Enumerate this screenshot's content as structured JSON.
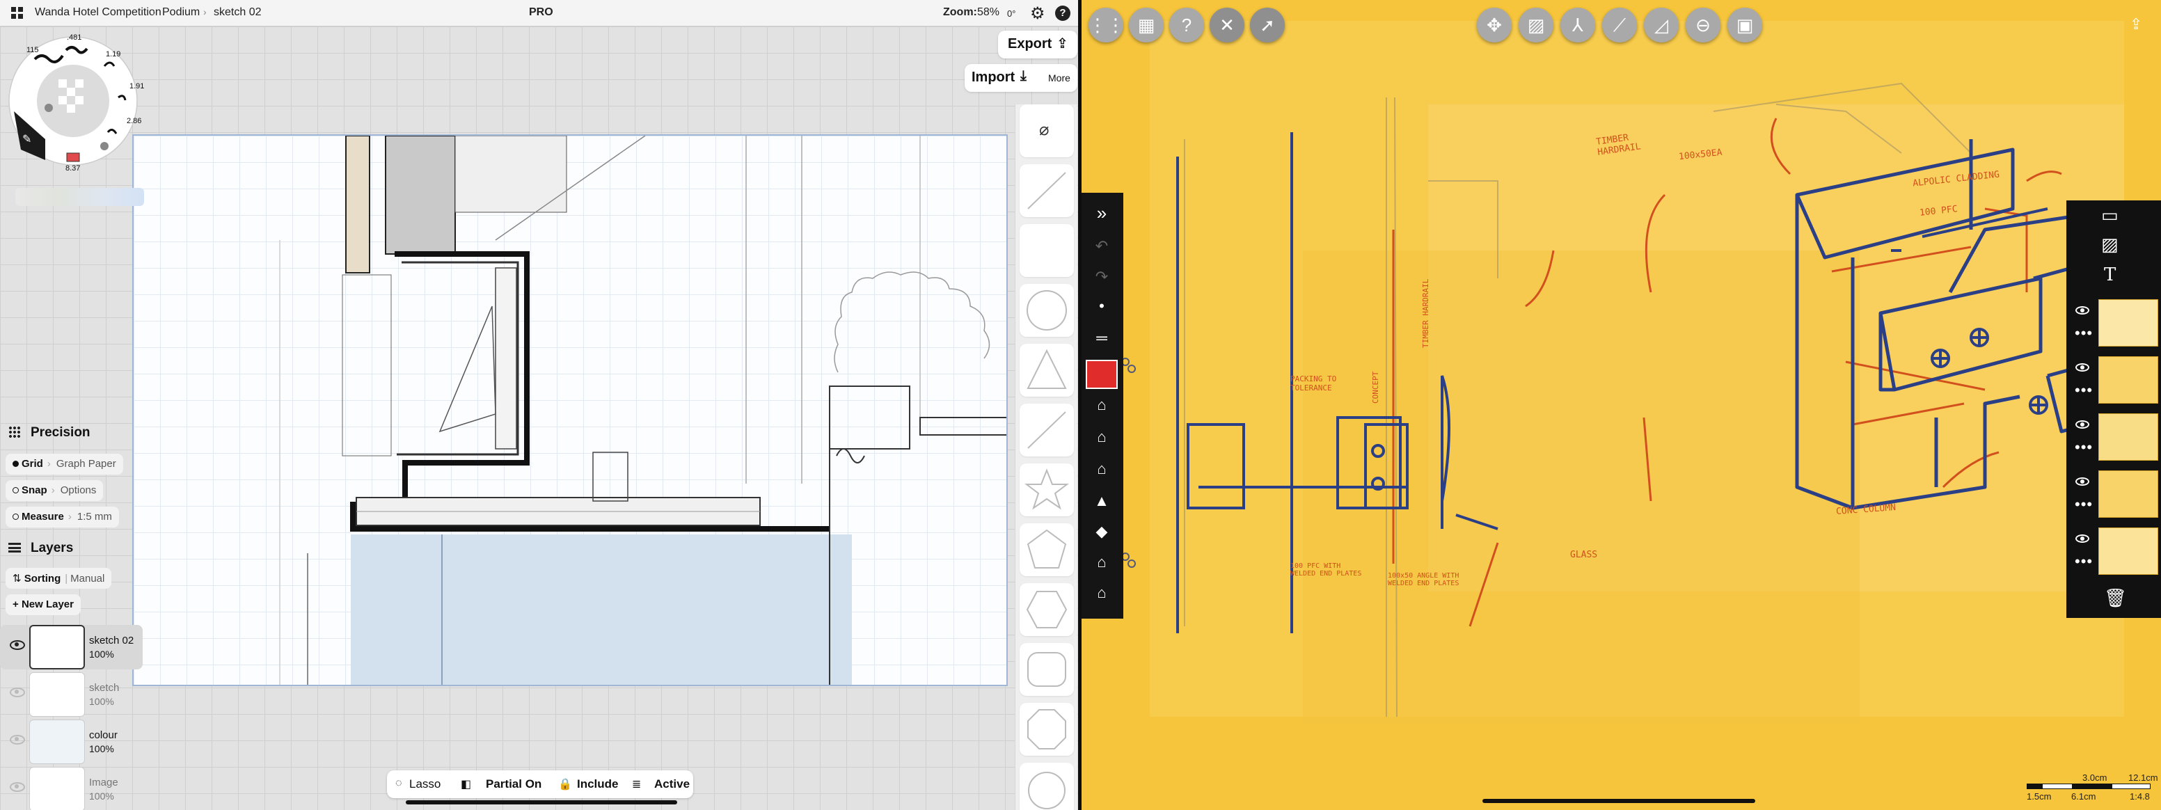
{
  "left": {
    "header": {
      "breadcrumb": [
        "Wanda Hotel Competition",
        "Podium",
        "sketch 02"
      ],
      "badge": "PRO",
      "zoom_label": "Zoom:",
      "zoom_value": "58%",
      "rotation": "0°"
    },
    "buttons": {
      "export": "Export",
      "import": "Import",
      "more": "More"
    },
    "wheel": {
      "sizes": [
        ".481",
        "1.19",
        "1.91",
        "2.86",
        "8.37",
        "115"
      ]
    },
    "precision": {
      "title": "Precision",
      "grid_label": "Grid",
      "grid_value": "Graph Paper",
      "snap_label": "Snap",
      "snap_value": "Options",
      "measure_label": "Measure",
      "measure_value": "1:5 mm"
    },
    "layers": {
      "title": "Layers",
      "sorting_label": "Sorting",
      "sorting_value": "Manual",
      "new_layer": "New Layer",
      "items": [
        {
          "name": "sketch 02",
          "opacity": "100%",
          "visible": true
        },
        {
          "name": "sketch",
          "opacity": "100%",
          "visible": false
        },
        {
          "name": "colour",
          "opacity": "100%",
          "visible": false
        },
        {
          "name": "Image",
          "opacity": "100%",
          "visible": false
        }
      ]
    },
    "bottombar": {
      "lasso": "Lasso",
      "partial": "Partial On",
      "include": "Include",
      "active": "Active"
    }
  },
  "right": {
    "sketch_labels": [
      "TIMBER HARDRAIL",
      "100x50EA",
      "ALPOLIC CLADDING",
      "100 PFC",
      "CONC COLUMN",
      "GLASS",
      "PACKING TO TOLERANCE",
      "100 PFC WITH WELDED END PLATES",
      "100x50 ANGLE WITH WELDED END PLATES",
      "TIMBER HARDRAIL",
      "CONCEPT"
    ],
    "scale": {
      "top": [
        "3.0cm",
        "12.1cm"
      ],
      "bottom": [
        "1.5cm",
        "6.1cm",
        "1:4.8"
      ]
    },
    "colors": {
      "paper": "#f6c53c",
      "pen_blue": "#2b3f86",
      "pen_orange": "#d2501e",
      "toolbar": "#151515"
    }
  }
}
